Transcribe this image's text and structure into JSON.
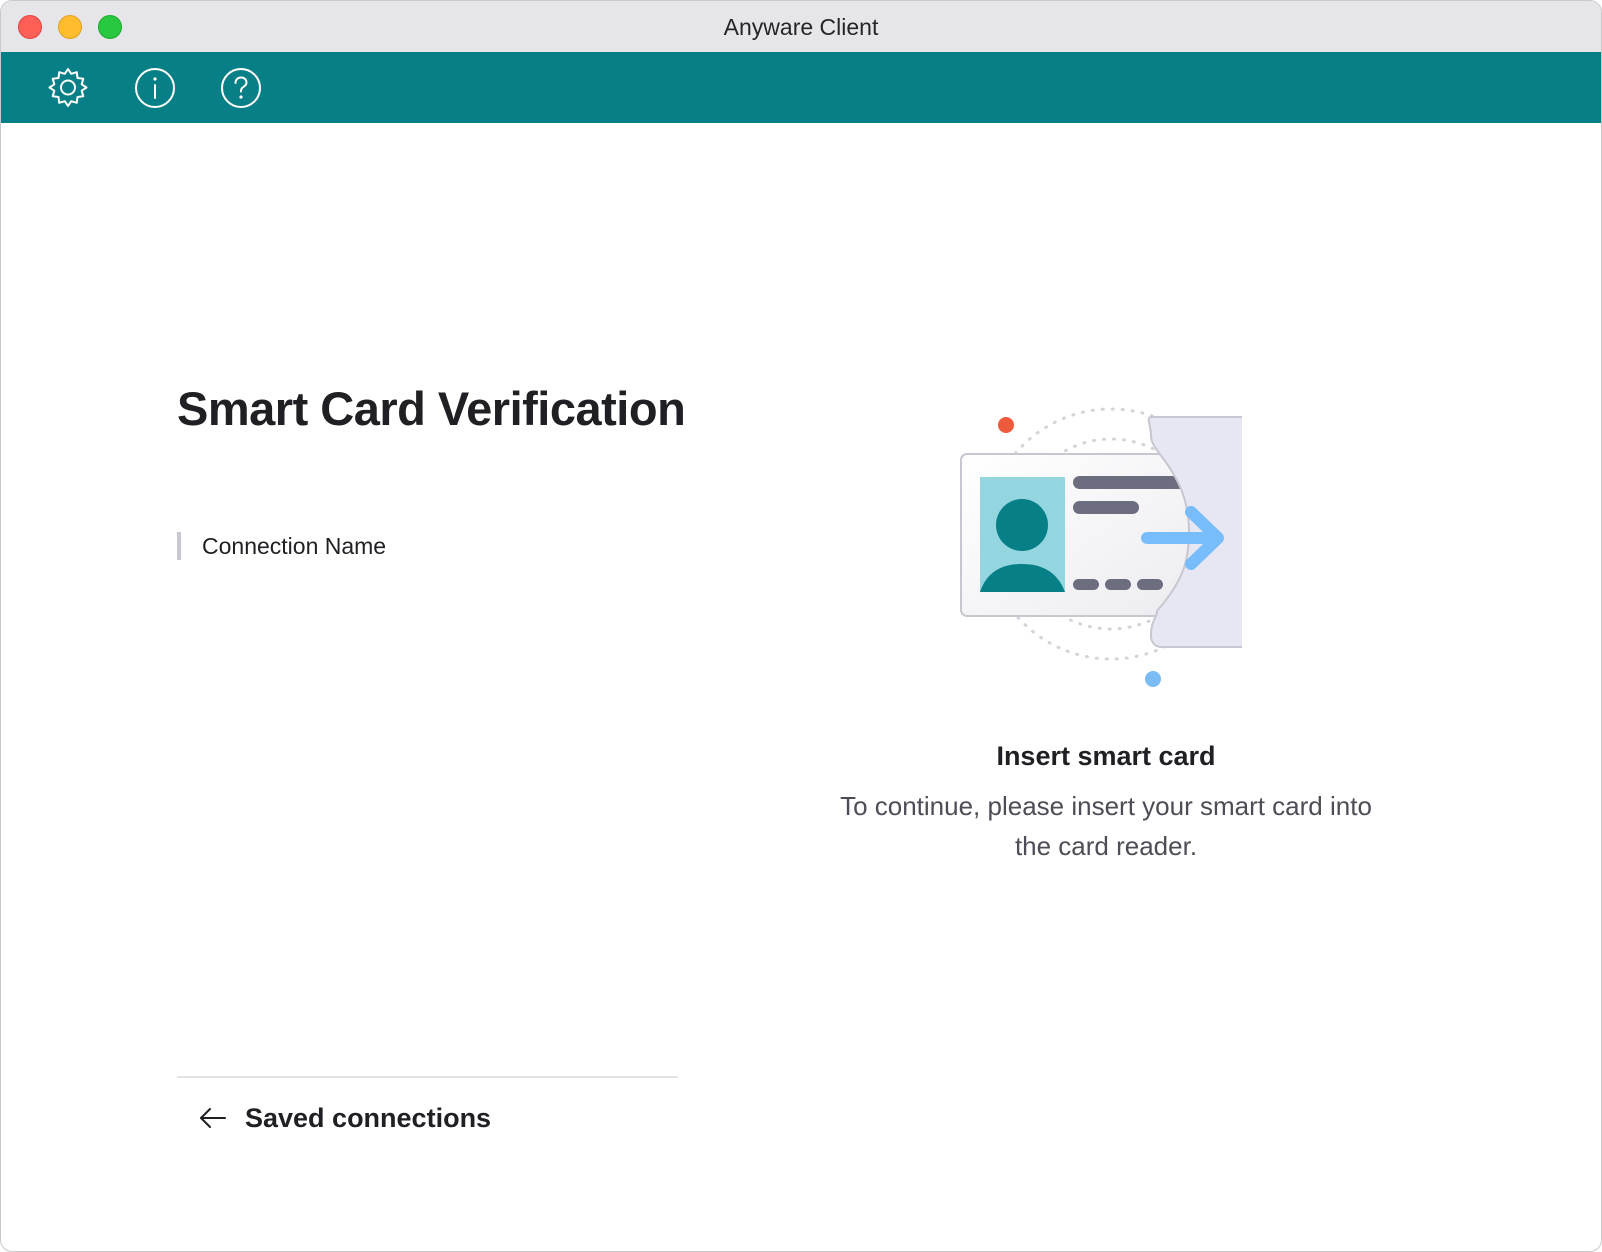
{
  "window": {
    "title": "Anyware Client"
  },
  "toolbar": {
    "icons": [
      "gear-icon",
      "info-icon",
      "help-icon"
    ],
    "background": "#077f87"
  },
  "main": {
    "title": "Smart Card Verification",
    "connection_name": "Connection Name",
    "back_label": "Saved connections"
  },
  "status": {
    "heading": "Insert smart card",
    "message": "To continue, please insert your smart card into the card reader."
  },
  "colors": {
    "accent": "#077f87",
    "card_photo": "#93d6df",
    "arrow": "#77bdfb",
    "dot_red": "#f05a3c",
    "dot_blue": "#79bcf6"
  }
}
